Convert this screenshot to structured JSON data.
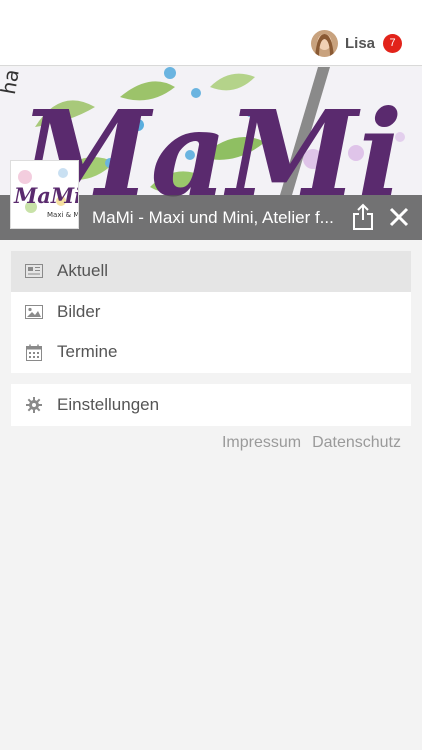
{
  "user": {
    "name": "Lisa",
    "notification_count": "7"
  },
  "header": {
    "title": "MaMi - Maxi und Mini, Atelier f..."
  },
  "logo": {
    "text_main": "MaMi",
    "text_sub": "Maxi & Mir"
  },
  "menu": {
    "items": [
      {
        "label": "Aktuell",
        "icon": "newspaper-icon",
        "active": true
      },
      {
        "label": "Bilder",
        "icon": "image-icon",
        "active": false
      },
      {
        "label": "Termine",
        "icon": "calendar-icon",
        "active": false
      }
    ],
    "settings": {
      "label": "Einstellungen",
      "icon": "gear-icon"
    }
  },
  "footer": {
    "impressum": "Impressum",
    "datenschutz": "Datenschutz"
  },
  "colors": {
    "badge": "#e2231a",
    "accent_purple": "#5a2a6e",
    "titlebar": "#555555"
  }
}
